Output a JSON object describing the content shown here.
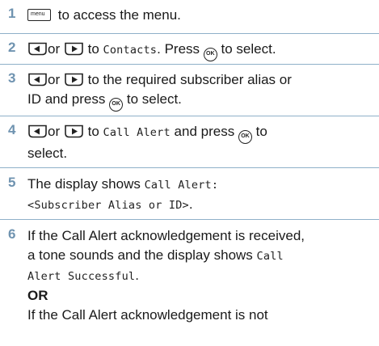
{
  "steps": [
    {
      "number": "1",
      "key_menu_label": "menu",
      "text": "to access the menu."
    },
    {
      "number": "2",
      "or": "or",
      "to": "to",
      "target": "Contacts",
      "after": ". Press",
      "ok_label": "OK",
      "end": "to select."
    },
    {
      "number": "3",
      "or": "or",
      "line1_rest": "to the required subscriber alias or",
      "line2_pre": "ID and press",
      "ok_label": "OK",
      "line2_end": "to select."
    },
    {
      "number": "4",
      "or": "or",
      "to": "to",
      "target": "Call Alert",
      "after": "and press",
      "ok_label": "OK",
      "end": "to",
      "line2": "select."
    },
    {
      "number": "5",
      "text": "The display shows",
      "mono1": "Call Alert:",
      "mono2": "<Subscriber Alias or ID>",
      "end": "."
    },
    {
      "number": "6",
      "line1": "If the Call Alert acknowledgement is received,",
      "line2_pre": "a tone sounds and the display shows",
      "mono_a": "Call",
      "mono_b": "Alert Successful",
      "mono_b_end": ".",
      "or_label": "OR",
      "line_last": "If the Call Alert acknowledgement is not"
    }
  ],
  "colors": {
    "step_number": "#6f93b0",
    "divider": "#8fb0c9",
    "text": "#1a1a1a"
  },
  "icons": {
    "left_key": "left-arrow-key-icon",
    "right_key": "right-arrow-key-icon",
    "menu_key": "menu-key-icon",
    "ok_key": "ok-key-icon"
  }
}
